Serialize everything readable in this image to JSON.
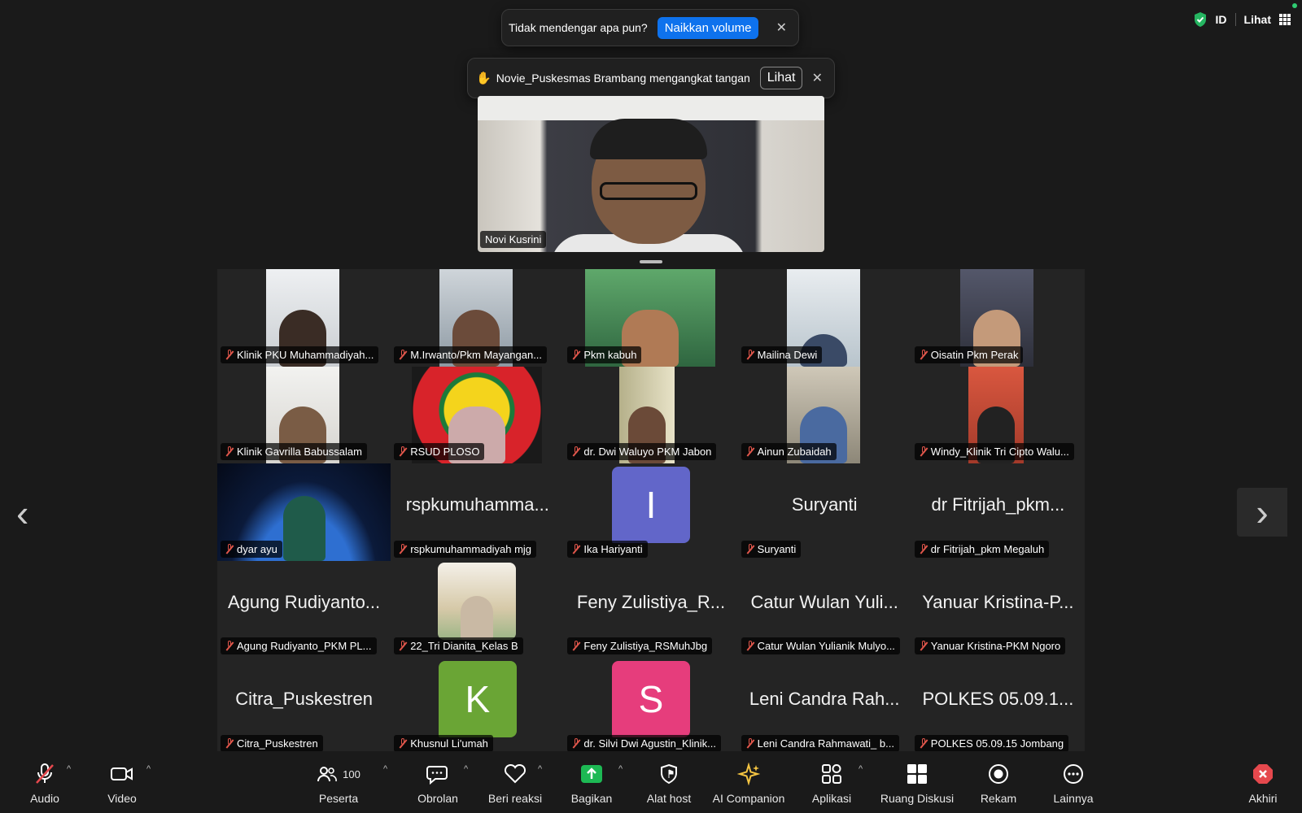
{
  "security": {
    "id_label": "ID",
    "view_label": "Lihat"
  },
  "notifications": {
    "volume": {
      "text": "Tidak mendengar apa pun?",
      "button": "Naikkan volume"
    },
    "raise_hand": {
      "text": "Novie_Puskesmas Brambang mengangkat tangan",
      "button": "Lihat"
    }
  },
  "speaker": {
    "name": "Novi Kusrini"
  },
  "tiles": [
    {
      "label": "Klinik PKU Muhammadiyah..."
    },
    {
      "label": "M.Irwanto/Pkm Mayangan..."
    },
    {
      "label": "Pkm kabuh"
    },
    {
      "label": "Mailina Dewi"
    },
    {
      "label": "Oisatin Pkm Perak"
    },
    {
      "label": "Klinik Gavrilla Babussalam"
    },
    {
      "label": "RSUD PLOSO"
    },
    {
      "label": "dr. Dwi Waluyo PKM Jabon"
    },
    {
      "label": "Ainun Zubaidah"
    },
    {
      "label": "Windy_Klinik Tri Cipto Walu..."
    },
    {
      "label": "dyar ayu"
    },
    {
      "label": "rspkumuhammadiyah mjg",
      "display": "rspkumuhamma..."
    },
    {
      "label": "Ika Hariyanti",
      "initial": "I"
    },
    {
      "label": "Suryanti",
      "display": "Suryanti"
    },
    {
      "label": "dr Fitrijah_pkm Megaluh",
      "display": "dr Fitrijah_pkm..."
    },
    {
      "label": "Agung Rudiyanto_PKM PL...",
      "display": "Agung Rudiyanto..."
    },
    {
      "label": "22_Tri Dianita_Kelas B"
    },
    {
      "label": "Feny Zulistiya_RSMuhJbg",
      "display": "Feny Zulistiya_R..."
    },
    {
      "label": "Catur Wulan Yulianik Mulyo...",
      "display": "Catur Wulan Yuli..."
    },
    {
      "label": "Yanuar Kristina-PKM Ngoro",
      "display": "Yanuar Kristina-P..."
    },
    {
      "label": "Citra_Puskestren",
      "display": "Citra_Puskestren"
    },
    {
      "label": "Khusnul Li'umah",
      "initial": "K"
    },
    {
      "label": "dr. Silvi Dwi Agustin_Klinik...",
      "initial": "S"
    },
    {
      "label": "Leni Candra Rahmawati_ b...",
      "display": "Leni Candra Rah..."
    },
    {
      "label": "POLKES 05.09.15 Jombang",
      "display": "POLKES 05.09.1..."
    }
  ],
  "toolbar": {
    "audio": "Audio",
    "video": "Video",
    "participants": "Peserta",
    "participants_count": "100",
    "chat": "Obrolan",
    "react": "Beri reaksi",
    "share": "Bagikan",
    "host_tools": "Alat host",
    "ai": "AI Companion",
    "apps": "Aplikasi",
    "breakout": "Ruang Diskusi",
    "record": "Rekam",
    "more": "Lainnya",
    "end": "Akhiri"
  },
  "colors": {
    "accent_blue": "#0e72ed",
    "share_green": "#1db954",
    "end_red": "#e5484d",
    "ai_yellow": "#f5c542",
    "avatar_I": "#6266c9",
    "avatar_K": "#6aa535",
    "avatar_S": "#e63d7c"
  }
}
